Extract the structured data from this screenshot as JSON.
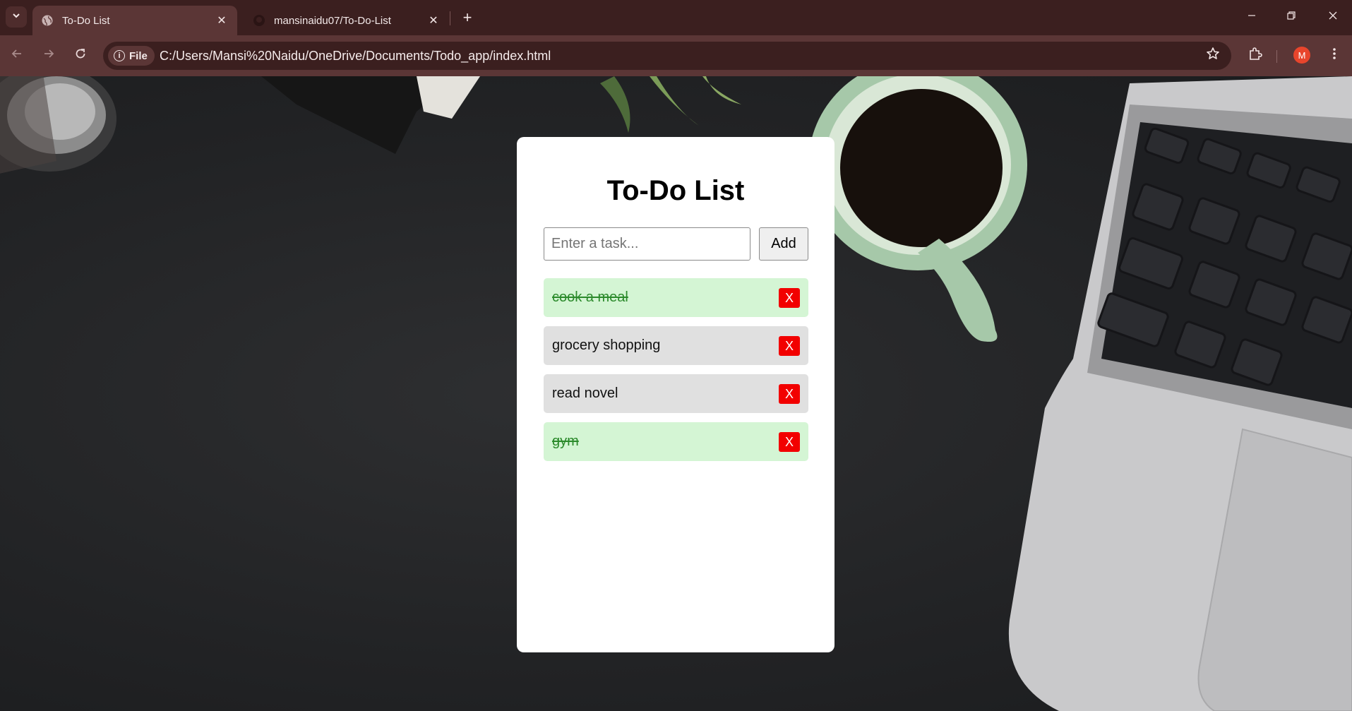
{
  "browser": {
    "tabs": [
      {
        "title": "To-Do List",
        "active": true
      },
      {
        "title": "mansinaidu07/To-Do-List",
        "active": false
      }
    ],
    "site_chip": "File",
    "url": "C:/Users/Mansi%20Naidu/OneDrive/Documents/Todo_app/index.html",
    "profile_initial": "M"
  },
  "app": {
    "title": "To-Do List",
    "input_placeholder": "Enter a task...",
    "add_label": "Add",
    "delete_label": "X",
    "tasks": [
      {
        "text": "cook a meal",
        "completed": true
      },
      {
        "text": "grocery shopping",
        "completed": false
      },
      {
        "text": "read novel",
        "completed": false
      },
      {
        "text": "gym",
        "completed": true
      }
    ]
  },
  "colors": {
    "chrome_dark": "#3b1f1f",
    "chrome_light": "#5b3636",
    "done_bg": "#d4f5d4",
    "done_text": "#2b8a2b",
    "pending_bg": "#e0e0e0",
    "delete_bg": "#f20000"
  }
}
